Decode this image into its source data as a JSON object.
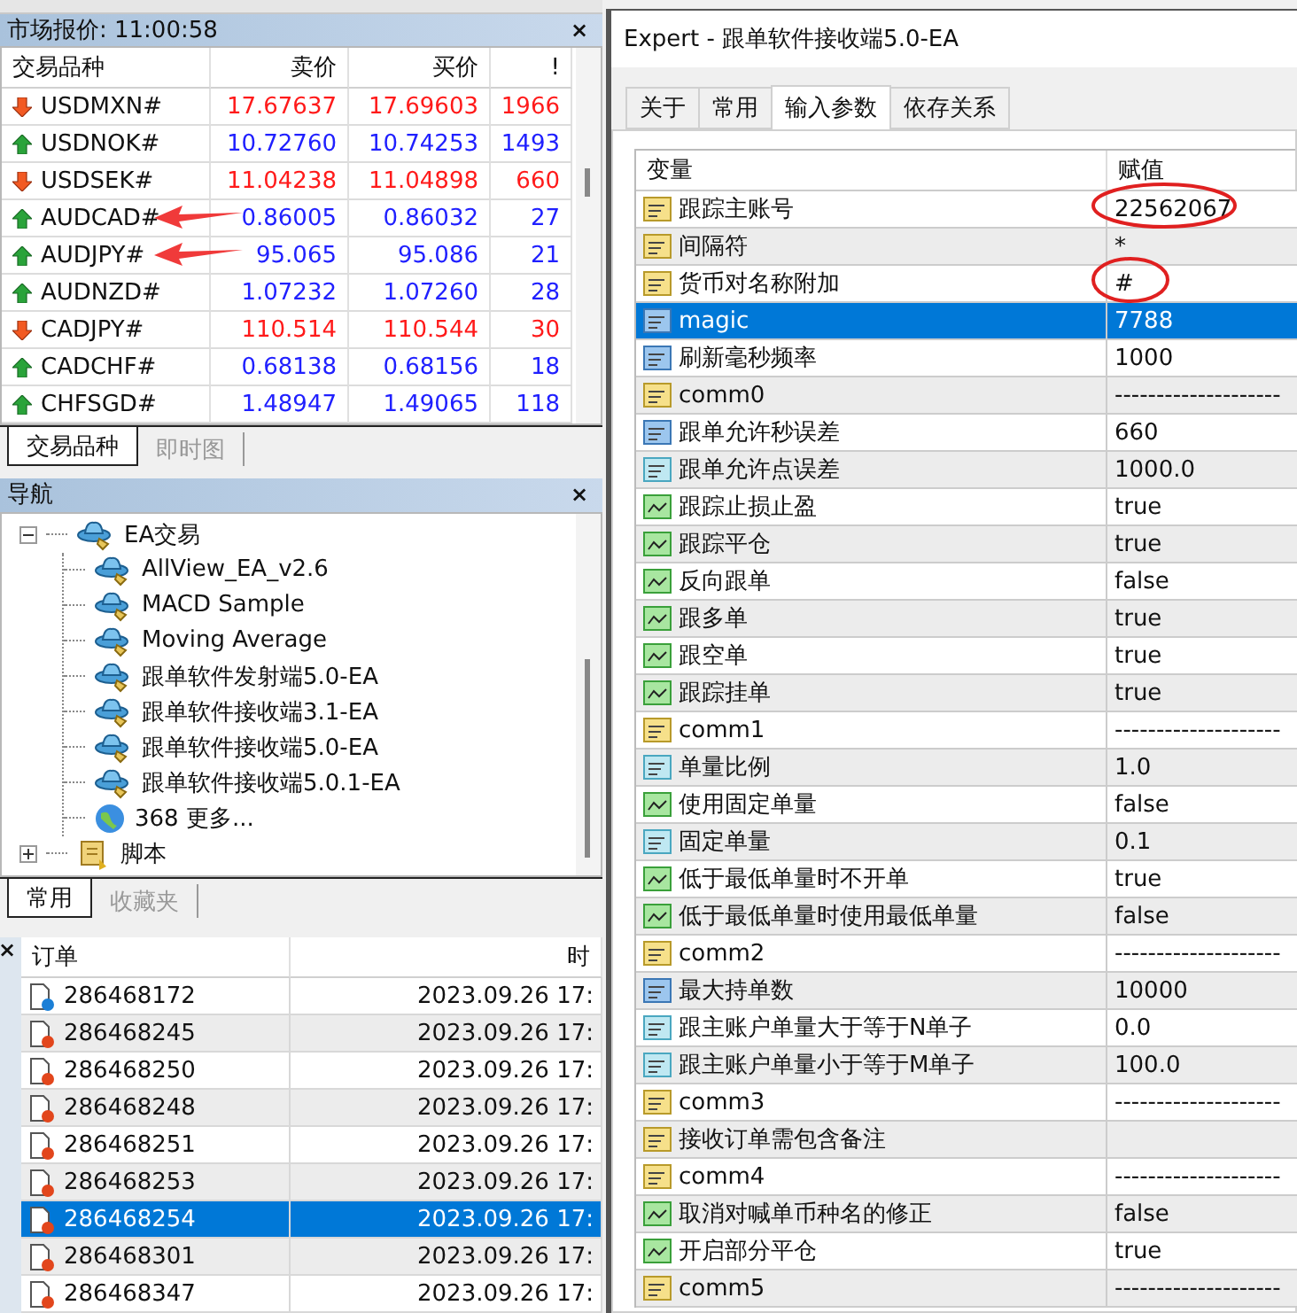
{
  "market_watch": {
    "title": "市场报价: 11:00:58",
    "close": "×",
    "columns": [
      "交易品种",
      "卖价",
      "买价",
      "!"
    ],
    "rows": [
      {
        "symbol": "USDMXN#",
        "bid": "17.67637",
        "ask": "17.69603",
        "spread": "1966",
        "kind": "down",
        "marked": false
      },
      {
        "symbol": "USDNOK#",
        "bid": "10.72760",
        "ask": "10.74253",
        "spread": "1493",
        "kind": "up",
        "marked": false
      },
      {
        "symbol": "USDSEK#",
        "bid": "11.04238",
        "ask": "11.04898",
        "spread": "660",
        "kind": "down",
        "marked": false
      },
      {
        "symbol": "AUDCAD#",
        "bid": "0.86005",
        "ask": "0.86032",
        "spread": "27",
        "kind": "up",
        "marked": true
      },
      {
        "symbol": "AUDJPY#",
        "bid": "95.065",
        "ask": "95.086",
        "spread": "21",
        "kind": "up",
        "marked": true
      },
      {
        "symbol": "AUDNZD#",
        "bid": "1.07232",
        "ask": "1.07260",
        "spread": "28",
        "kind": "up",
        "marked": false
      },
      {
        "symbol": "CADJPY#",
        "bid": "110.514",
        "ask": "110.544",
        "spread": "30",
        "kind": "down",
        "marked": false
      },
      {
        "symbol": "CADCHF#",
        "bid": "0.68138",
        "ask": "0.68156",
        "spread": "18",
        "kind": "up",
        "marked": false
      },
      {
        "symbol": "CHFSGD#",
        "bid": "1.48947",
        "ask": "1.49065",
        "spread": "118",
        "kind": "up",
        "marked": false
      }
    ],
    "tabs": [
      {
        "label": "交易品种",
        "selected": true
      },
      {
        "label": "即时图",
        "selected": false
      }
    ]
  },
  "navigator": {
    "title": "导航",
    "close": "×",
    "tree": [
      {
        "label": "EA交易",
        "kind": "folder",
        "expanded": true,
        "children": [
          {
            "label": "AllView_EA_v2.6",
            "kind": "expert"
          },
          {
            "label": "MACD Sample",
            "kind": "expert"
          },
          {
            "label": "Moving Average",
            "kind": "expert"
          },
          {
            "label": "跟单软件发射端5.0-EA",
            "kind": "expert"
          },
          {
            "label": "跟单软件接收端3.1-EA",
            "kind": "expert"
          },
          {
            "label": "跟单软件接收端5.0-EA",
            "kind": "expert"
          },
          {
            "label": "跟单软件接收端5.0.1-EA",
            "kind": "expert"
          },
          {
            "label": "368 更多...",
            "kind": "more"
          }
        ]
      },
      {
        "label": "脚本",
        "kind": "scripts",
        "expanded": false
      }
    ],
    "tabs": [
      {
        "label": "常用",
        "selected": true
      },
      {
        "label": "收藏夹",
        "selected": false
      }
    ]
  },
  "orders": {
    "close": "×",
    "columns": [
      "订单",
      "时"
    ],
    "rows": [
      {
        "order": "286468172",
        "time": "2023.09.26 17:",
        "kind": "buy",
        "selected": false
      },
      {
        "order": "286468245",
        "time": "2023.09.26 17:",
        "kind": "sell",
        "selected": false
      },
      {
        "order": "286468250",
        "time": "2023.09.26 17:",
        "kind": "sell",
        "selected": false
      },
      {
        "order": "286468248",
        "time": "2023.09.26 17:",
        "kind": "sell",
        "selected": false
      },
      {
        "order": "286468251",
        "time": "2023.09.26 17:",
        "kind": "sell",
        "selected": false
      },
      {
        "order": "286468253",
        "time": "2023.09.26 17:",
        "kind": "sell",
        "selected": false
      },
      {
        "order": "286468254",
        "time": "2023.09.26 17:",
        "kind": "sell",
        "selected": true
      },
      {
        "order": "286468301",
        "time": "2023.09.26 17:",
        "kind": "sell",
        "selected": false
      },
      {
        "order": "286468347",
        "time": "2023.09.26 17:",
        "kind": "sell",
        "selected": false
      }
    ]
  },
  "dialog": {
    "title": "Expert - 跟单软件接收端5.0-EA",
    "tabs": [
      {
        "label": "关于",
        "selected": false
      },
      {
        "label": "常用",
        "selected": false
      },
      {
        "label": "输入参数",
        "selected": true
      },
      {
        "label": "依存关系",
        "selected": false
      }
    ],
    "columns": [
      "变量",
      "赋值"
    ],
    "params": [
      {
        "name": "跟踪主账号",
        "value": "22562067",
        "kind": "string",
        "selected": false,
        "circled": true
      },
      {
        "name": "间隔符",
        "value": "*",
        "kind": "string",
        "selected": false,
        "circled": false
      },
      {
        "name": "货币对名称附加",
        "value": "#",
        "kind": "string",
        "selected": false,
        "circled": true
      },
      {
        "name": "magic",
        "value": "7788",
        "kind": "int",
        "selected": true,
        "circled": false
      },
      {
        "name": "刷新毫秒频率",
        "value": "1000",
        "kind": "int",
        "selected": false,
        "circled": false
      },
      {
        "name": "comm0",
        "value": "--------------------",
        "kind": "string",
        "selected": false,
        "circled": false
      },
      {
        "name": "跟单允许秒误差",
        "value": "660",
        "kind": "int",
        "selected": false,
        "circled": false
      },
      {
        "name": "跟单允许点误差",
        "value": "1000.0",
        "kind": "double",
        "selected": false,
        "circled": false
      },
      {
        "name": "跟踪止损止盈",
        "value": "true",
        "kind": "bool",
        "selected": false,
        "circled": false
      },
      {
        "name": "跟踪平仓",
        "value": "true",
        "kind": "bool",
        "selected": false,
        "circled": false
      },
      {
        "name": "反向跟单",
        "value": "false",
        "kind": "bool",
        "selected": false,
        "circled": false
      },
      {
        "name": "跟多单",
        "value": "true",
        "kind": "bool",
        "selected": false,
        "circled": false
      },
      {
        "name": "跟空单",
        "value": "true",
        "kind": "bool",
        "selected": false,
        "circled": false
      },
      {
        "name": "跟踪挂单",
        "value": "true",
        "kind": "bool",
        "selected": false,
        "circled": false
      },
      {
        "name": "comm1",
        "value": "--------------------",
        "kind": "string",
        "selected": false,
        "circled": false
      },
      {
        "name": "单量比例",
        "value": "1.0",
        "kind": "double",
        "selected": false,
        "circled": false
      },
      {
        "name": "使用固定单量",
        "value": "false",
        "kind": "bool",
        "selected": false,
        "circled": false
      },
      {
        "name": "固定单量",
        "value": "0.1",
        "kind": "double",
        "selected": false,
        "circled": false
      },
      {
        "name": "低于最低单量时不开单",
        "value": "true",
        "kind": "bool",
        "selected": false,
        "circled": false
      },
      {
        "name": "低于最低单量时使用最低单量",
        "value": "false",
        "kind": "bool",
        "selected": false,
        "circled": false
      },
      {
        "name": "comm2",
        "value": "--------------------",
        "kind": "string",
        "selected": false,
        "circled": false
      },
      {
        "name": "最大持单数",
        "value": "10000",
        "kind": "int",
        "selected": false,
        "circled": false
      },
      {
        "name": "跟主账户单量大于等于N单子",
        "value": "0.0",
        "kind": "double",
        "selected": false,
        "circled": false
      },
      {
        "name": "跟主账户单量小于等于M单子",
        "value": "100.0",
        "kind": "double",
        "selected": false,
        "circled": false
      },
      {
        "name": "comm3",
        "value": "--------------------",
        "kind": "string",
        "selected": false,
        "circled": false
      },
      {
        "name": "接收订单需包含备注",
        "kind": "string",
        "selected": false,
        "circled": false
      },
      {
        "name": "comm4",
        "value": "--------------------",
        "kind": "string",
        "selected": false,
        "circled": false
      },
      {
        "name": "取消对喊单币种名的修正",
        "value": "false",
        "kind": "bool",
        "selected": false,
        "circled": false
      },
      {
        "name": "开启部分平仓",
        "value": "true",
        "kind": "bool",
        "selected": false,
        "circled": false
      },
      {
        "name": "comm5",
        "value": "--------------------",
        "kind": "string",
        "selected": false,
        "circled": false
      }
    ]
  }
}
